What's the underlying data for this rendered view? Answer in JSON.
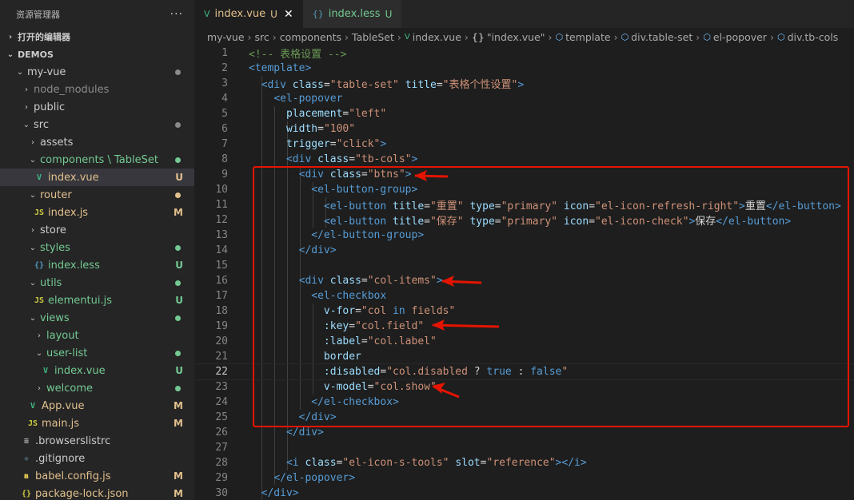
{
  "sidebar": {
    "title": "资源管理器",
    "more": "···",
    "open_editors": "打开的编辑器",
    "workspace": "DEMOS",
    "tree": [
      {
        "label": "my-vue",
        "chev": "⌄",
        "indent": 18,
        "icon": "",
        "color": "white",
        "status": "dot-gray"
      },
      {
        "label": "node_modules",
        "chev": "›",
        "indent": 26,
        "icon": "",
        "color": "gray",
        "status": ""
      },
      {
        "label": "public",
        "chev": "›",
        "indent": 26,
        "icon": "",
        "color": "white",
        "status": ""
      },
      {
        "label": "src",
        "chev": "⌄",
        "indent": 26,
        "icon": "",
        "color": "white",
        "status": "dot-gray"
      },
      {
        "label": "assets",
        "chev": "›",
        "indent": 34,
        "icon": "",
        "color": "white",
        "status": ""
      },
      {
        "label": "components \\ TableSet",
        "chev": "⌄",
        "indent": 34,
        "icon": "",
        "color": "green",
        "status": "dot-green"
      },
      {
        "label": "index.vue",
        "chev": "",
        "indent": 42,
        "icon": "vue",
        "color": "yellow",
        "status": "U",
        "selected": true
      },
      {
        "label": "router",
        "chev": "⌄",
        "indent": 34,
        "icon": "",
        "color": "yellow",
        "status": "dot-yellow"
      },
      {
        "label": "index.js",
        "chev": "",
        "indent": 42,
        "icon": "js",
        "color": "yellow",
        "status": "M"
      },
      {
        "label": "store",
        "chev": "›",
        "indent": 34,
        "icon": "",
        "color": "white",
        "status": ""
      },
      {
        "label": "styles",
        "chev": "⌄",
        "indent": 34,
        "icon": "",
        "color": "green",
        "status": "dot-green"
      },
      {
        "label": "index.less",
        "chev": "",
        "indent": 42,
        "icon": "less",
        "color": "green",
        "status": "U"
      },
      {
        "label": "utils",
        "chev": "⌄",
        "indent": 34,
        "icon": "",
        "color": "green",
        "status": "dot-green"
      },
      {
        "label": "elementui.js",
        "chev": "",
        "indent": 42,
        "icon": "js",
        "color": "green",
        "status": "U"
      },
      {
        "label": "views",
        "chev": "⌄",
        "indent": 34,
        "icon": "",
        "color": "green",
        "status": "dot-green"
      },
      {
        "label": "layout",
        "chev": "›",
        "indent": 42,
        "icon": "",
        "color": "green",
        "status": ""
      },
      {
        "label": "user-list",
        "chev": "⌄",
        "indent": 42,
        "icon": "",
        "color": "green",
        "status": "dot-green"
      },
      {
        "label": "index.vue",
        "chev": "",
        "indent": 50,
        "icon": "vue",
        "color": "green",
        "status": "U"
      },
      {
        "label": "welcome",
        "chev": "›",
        "indent": 42,
        "icon": "",
        "color": "green",
        "status": "dot-green"
      },
      {
        "label": "App.vue",
        "chev": "",
        "indent": 34,
        "icon": "vue",
        "color": "yellow",
        "status": "M"
      },
      {
        "label": "main.js",
        "chev": "",
        "indent": 34,
        "icon": "js",
        "color": "yellow",
        "status": "M"
      },
      {
        "label": ".browserslistrc",
        "chev": "",
        "indent": 26,
        "icon": "list",
        "color": "white",
        "status": ""
      },
      {
        "label": ".gitignore",
        "chev": "",
        "indent": 26,
        "icon": "git",
        "color": "white",
        "status": ""
      },
      {
        "label": "babel.config.js",
        "chev": "",
        "indent": 26,
        "icon": "babel",
        "color": "yellow",
        "status": "M"
      },
      {
        "label": "package-lock.json",
        "chev": "",
        "indent": 26,
        "icon": "json",
        "color": "yellow",
        "status": "M"
      }
    ]
  },
  "tabs": [
    {
      "label": "index.vue",
      "badge": "U",
      "icon": "vue",
      "active": true
    },
    {
      "label": "index.less",
      "badge": "U",
      "icon": "less",
      "active": false
    }
  ],
  "breadcrumb": [
    "my-vue",
    "src",
    "components",
    "TableSet",
    "index.vue",
    "\"index.vue\"",
    "template",
    "div.table-set",
    "el-popover",
    "div.tb-cols"
  ],
  "icons": {
    "vue": "V",
    "js": "JS",
    "less": "{}",
    "json": "{}",
    "babel": "ʙ",
    "list": "≡",
    "git": "◆",
    "close": "✕"
  },
  "current_line": 22,
  "code": [
    [
      [
        "c",
        "<!-- 表格设置 -->"
      ]
    ],
    [
      [
        "t",
        "<template>"
      ]
    ],
    [
      [
        "p",
        "  "
      ],
      [
        "t",
        "<div "
      ],
      [
        "a",
        "class"
      ],
      [
        "p",
        "="
      ],
      [
        "s",
        "\"table-set\""
      ],
      [
        "p",
        " "
      ],
      [
        "a",
        "title"
      ],
      [
        "p",
        "="
      ],
      [
        "s",
        "\"表格个性设置\""
      ],
      [
        "t",
        ">"
      ]
    ],
    [
      [
        "p",
        "    "
      ],
      [
        "t",
        "<el-popover"
      ]
    ],
    [
      [
        "p",
        "      "
      ],
      [
        "a",
        "placement"
      ],
      [
        "p",
        "="
      ],
      [
        "s",
        "\"left\""
      ]
    ],
    [
      [
        "p",
        "      "
      ],
      [
        "a",
        "width"
      ],
      [
        "p",
        "="
      ],
      [
        "s",
        "\"100\""
      ]
    ],
    [
      [
        "p",
        "      "
      ],
      [
        "a",
        "trigger"
      ],
      [
        "p",
        "="
      ],
      [
        "s",
        "\"click\""
      ],
      [
        "t",
        ">"
      ]
    ],
    [
      [
        "p",
        "      "
      ],
      [
        "t",
        "<div "
      ],
      [
        "a",
        "class"
      ],
      [
        "p",
        "="
      ],
      [
        "s",
        "\"tb-cols\""
      ],
      [
        "t",
        ">"
      ]
    ],
    [
      [
        "p",
        "        "
      ],
      [
        "t",
        "<div "
      ],
      [
        "a",
        "class"
      ],
      [
        "p",
        "="
      ],
      [
        "s",
        "\"btns\""
      ],
      [
        "t",
        ">"
      ]
    ],
    [
      [
        "p",
        "          "
      ],
      [
        "t",
        "<el-button-group>"
      ]
    ],
    [
      [
        "p",
        "            "
      ],
      [
        "t",
        "<el-button "
      ],
      [
        "a",
        "title"
      ],
      [
        "p",
        "="
      ],
      [
        "s",
        "\"重置\""
      ],
      [
        "p",
        " "
      ],
      [
        "a",
        "type"
      ],
      [
        "p",
        "="
      ],
      [
        "s",
        "\"primary\""
      ],
      [
        "p",
        " "
      ],
      [
        "a",
        "icon"
      ],
      [
        "p",
        "="
      ],
      [
        "s",
        "\"el-icon-refresh-right\""
      ],
      [
        "t",
        ">"
      ],
      [
        "p",
        "重置"
      ],
      [
        "t",
        "</el-button>"
      ]
    ],
    [
      [
        "p",
        "            "
      ],
      [
        "t",
        "<el-button "
      ],
      [
        "a",
        "title"
      ],
      [
        "p",
        "="
      ],
      [
        "s",
        "\"保存\""
      ],
      [
        "p",
        " "
      ],
      [
        "a",
        "type"
      ],
      [
        "p",
        "="
      ],
      [
        "s",
        "\"primary\""
      ],
      [
        "p",
        " "
      ],
      [
        "a",
        "icon"
      ],
      [
        "p",
        "="
      ],
      [
        "s",
        "\"el-icon-check\""
      ],
      [
        "t",
        ">"
      ],
      [
        "p",
        "保存"
      ],
      [
        "t",
        "</el-button>"
      ]
    ],
    [
      [
        "p",
        "          "
      ],
      [
        "t",
        "</el-button-group>"
      ]
    ],
    [
      [
        "p",
        "        "
      ],
      [
        "t",
        "</div>"
      ]
    ],
    [],
    [
      [
        "p",
        "        "
      ],
      [
        "t",
        "<div "
      ],
      [
        "a",
        "class"
      ],
      [
        "p",
        "="
      ],
      [
        "s",
        "\"col-items\""
      ],
      [
        "t",
        ">"
      ]
    ],
    [
      [
        "p",
        "          "
      ],
      [
        "t",
        "<el-checkbox"
      ]
    ],
    [
      [
        "p",
        "            "
      ],
      [
        "a",
        "v-for"
      ],
      [
        "p",
        "="
      ],
      [
        "s",
        "\"col "
      ],
      [
        "k",
        "in"
      ],
      [
        "s",
        " fields\""
      ]
    ],
    [
      [
        "p",
        "            "
      ],
      [
        "a",
        ":key"
      ],
      [
        "p",
        "="
      ],
      [
        "s",
        "\"col.field\""
      ]
    ],
    [
      [
        "p",
        "            "
      ],
      [
        "a",
        ":label"
      ],
      [
        "p",
        "="
      ],
      [
        "s",
        "\"col.label\""
      ]
    ],
    [
      [
        "p",
        "            "
      ],
      [
        "a",
        "border"
      ]
    ],
    [
      [
        "p",
        "            "
      ],
      [
        "a",
        ":disabled"
      ],
      [
        "p",
        "="
      ],
      [
        "s",
        "\"col.disabled "
      ],
      [
        "p",
        "? "
      ],
      [
        "k",
        "true"
      ],
      [
        "p",
        " : "
      ],
      [
        "k",
        "false"
      ],
      [
        "s",
        "\""
      ]
    ],
    [
      [
        "p",
        "            "
      ],
      [
        "a",
        "v-model"
      ],
      [
        "p",
        "="
      ],
      [
        "s",
        "\"col.show\""
      ]
    ],
    [
      [
        "p",
        "          "
      ],
      [
        "t",
        "</el-checkbox>"
      ]
    ],
    [
      [
        "p",
        "        "
      ],
      [
        "t",
        "</div>"
      ]
    ],
    [
      [
        "p",
        "      "
      ],
      [
        "t",
        "</div>"
      ]
    ],
    [],
    [
      [
        "p",
        "      "
      ],
      [
        "t",
        "<i "
      ],
      [
        "a",
        "class"
      ],
      [
        "p",
        "="
      ],
      [
        "s",
        "\"el-icon-s-tools\""
      ],
      [
        "p",
        " "
      ],
      [
        "a",
        "slot"
      ],
      [
        "p",
        "="
      ],
      [
        "s",
        "\"reference\""
      ],
      [
        "t",
        "></i>"
      ]
    ],
    [
      [
        "p",
        "    "
      ],
      [
        "t",
        "</el-popover>"
      ]
    ],
    [
      [
        "p",
        "  "
      ],
      [
        "t",
        "</div>"
      ]
    ]
  ],
  "colors": {
    "annotation": "#e51400",
    "green": "#73c991",
    "yellow": "#e2c08d",
    "vue": "#41b883"
  }
}
